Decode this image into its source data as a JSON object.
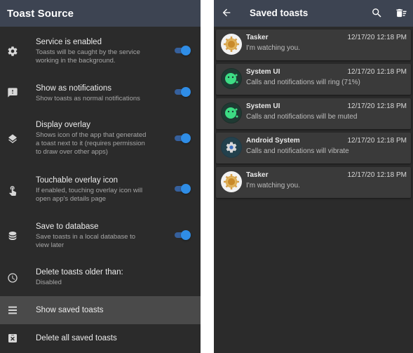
{
  "left": {
    "app_title": "Toast Source",
    "prefs": [
      {
        "title": "Service is enabled",
        "summary": [
          "Toasts will be caught by the service",
          "working in the background."
        ],
        "toggle": true,
        "icon": "gear-icon"
      },
      {
        "title": "Show as notifications",
        "summary": [
          "Show toasts as normal notifications"
        ],
        "toggle": true,
        "icon": "notification-icon"
      },
      {
        "title": "Display overlay",
        "summary": [
          "Shows icon of the app that generated",
          "a toast next to it (requires permission",
          "to draw over other apps)"
        ],
        "toggle": true,
        "icon": "layers-icon"
      },
      {
        "title": "Touchable overlay icon",
        "summary": [
          "If enabled, touching overlay icon will",
          "open app's details page"
        ],
        "toggle": true,
        "icon": "touch-icon"
      },
      {
        "title": "Save to database",
        "summary": [
          "Save toasts in a local database to",
          "view later"
        ],
        "toggle": true,
        "icon": "database-icon"
      },
      {
        "title": "Delete toasts older than:",
        "summary": [
          "Disabled"
        ],
        "toggle": false,
        "icon": "clock-icon"
      },
      {
        "title": "Show saved toasts",
        "summary": [],
        "toggle": false,
        "icon": "list-icon",
        "selected": true
      },
      {
        "title": "Delete all saved toasts",
        "summary": [],
        "toggle": false,
        "icon": "delete-box-icon"
      }
    ]
  },
  "right": {
    "title": "Saved toasts",
    "toasts": [
      {
        "app": "Tasker",
        "time": "12/17/20 12:18 PM",
        "message": "I'm watching you.",
        "icon": "tasker-icon"
      },
      {
        "app": "System UI",
        "time": "12/17/20 12:18 PM",
        "message": "Calls and notifications will ring (71%)",
        "icon": "android-icon"
      },
      {
        "app": "System UI",
        "time": "12/17/20 12:18 PM",
        "message": "Calls and notifications will be muted",
        "icon": "android-icon"
      },
      {
        "app": "Android System",
        "time": "12/17/20 12:18 PM",
        "message": "Calls and notifications will vibrate",
        "icon": "system-gear-icon"
      },
      {
        "app": "Tasker",
        "time": "12/17/20 12:18 PM",
        "message": "I'm watching you.",
        "icon": "tasker-icon"
      }
    ]
  },
  "colors": {
    "appbar": "#3d4452",
    "background": "#2b2b2b",
    "toggle_on": "#2f8de6",
    "card": "#3a3a3a"
  }
}
